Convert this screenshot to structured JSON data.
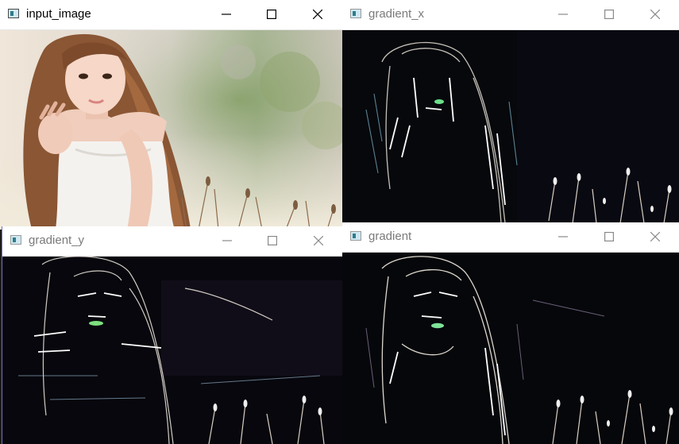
{
  "windows": {
    "input": {
      "title": "input_image",
      "active": true
    },
    "gradient_x": {
      "title": "gradient_x",
      "active": false
    },
    "gradient_y": {
      "title": "gradient_y",
      "active": false
    },
    "gradient": {
      "title": "gradient",
      "active": false
    }
  },
  "window_controls": {
    "minimize_icon": "minimize-icon",
    "maximize_icon": "maximize-icon",
    "close_icon": "close-icon"
  },
  "colors": {
    "titlebar_background": "#ffffff",
    "active_title_text": "#000000",
    "inactive_title_text": "#7a7a7a",
    "gradient_image_background": "#05070b",
    "edge_highlight": "#e8e3d8"
  }
}
